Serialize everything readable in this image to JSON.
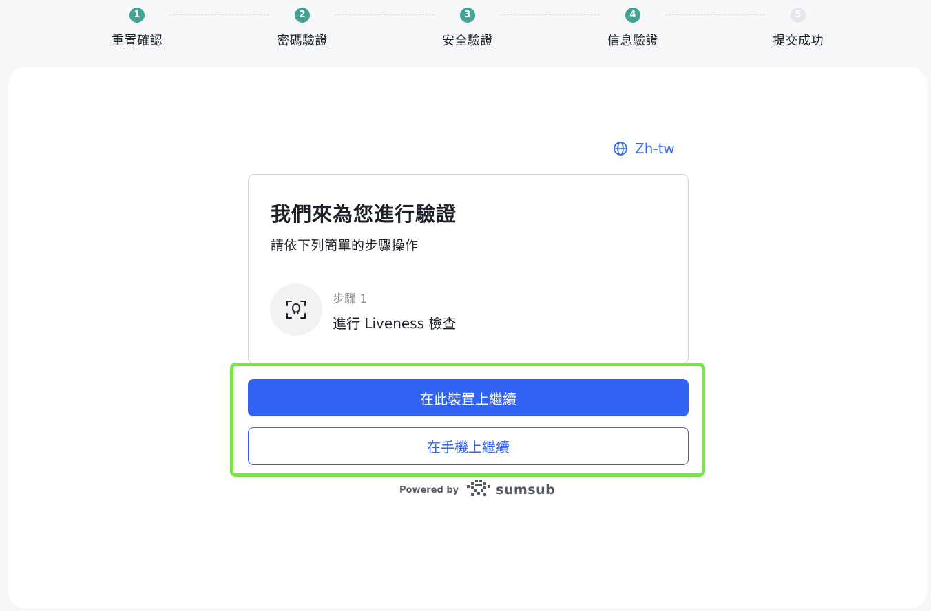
{
  "stepper": {
    "steps": [
      {
        "number": "1",
        "label": "重置確認",
        "status": "done"
      },
      {
        "number": "2",
        "label": "密碼驗證",
        "status": "done"
      },
      {
        "number": "3",
        "label": "安全驗證",
        "status": "done"
      },
      {
        "number": "4",
        "label": "信息驗證",
        "status": "done"
      },
      {
        "number": "5",
        "label": "提交成功",
        "status": "pending"
      }
    ],
    "done_color": "#45a392",
    "pending_color": "#e6e7ea"
  },
  "language": {
    "label": "Zh-tw",
    "icon": "globe-icon"
  },
  "card": {
    "title": "我們來為您進行驗證",
    "subtitle": "請依下列簡單的步驟操作",
    "step": {
      "number_label": "步驟 1",
      "title": "進行 Liveness 檢查",
      "icon": "face-scan-icon"
    }
  },
  "actions": {
    "continue_here": "在此裝置上繼續",
    "continue_phone": "在手機上繼續",
    "primary_color": "#3262f2",
    "highlight_color": "#7be34a"
  },
  "footer": {
    "powered_by": "Powered by",
    "brand": "sumsub"
  }
}
